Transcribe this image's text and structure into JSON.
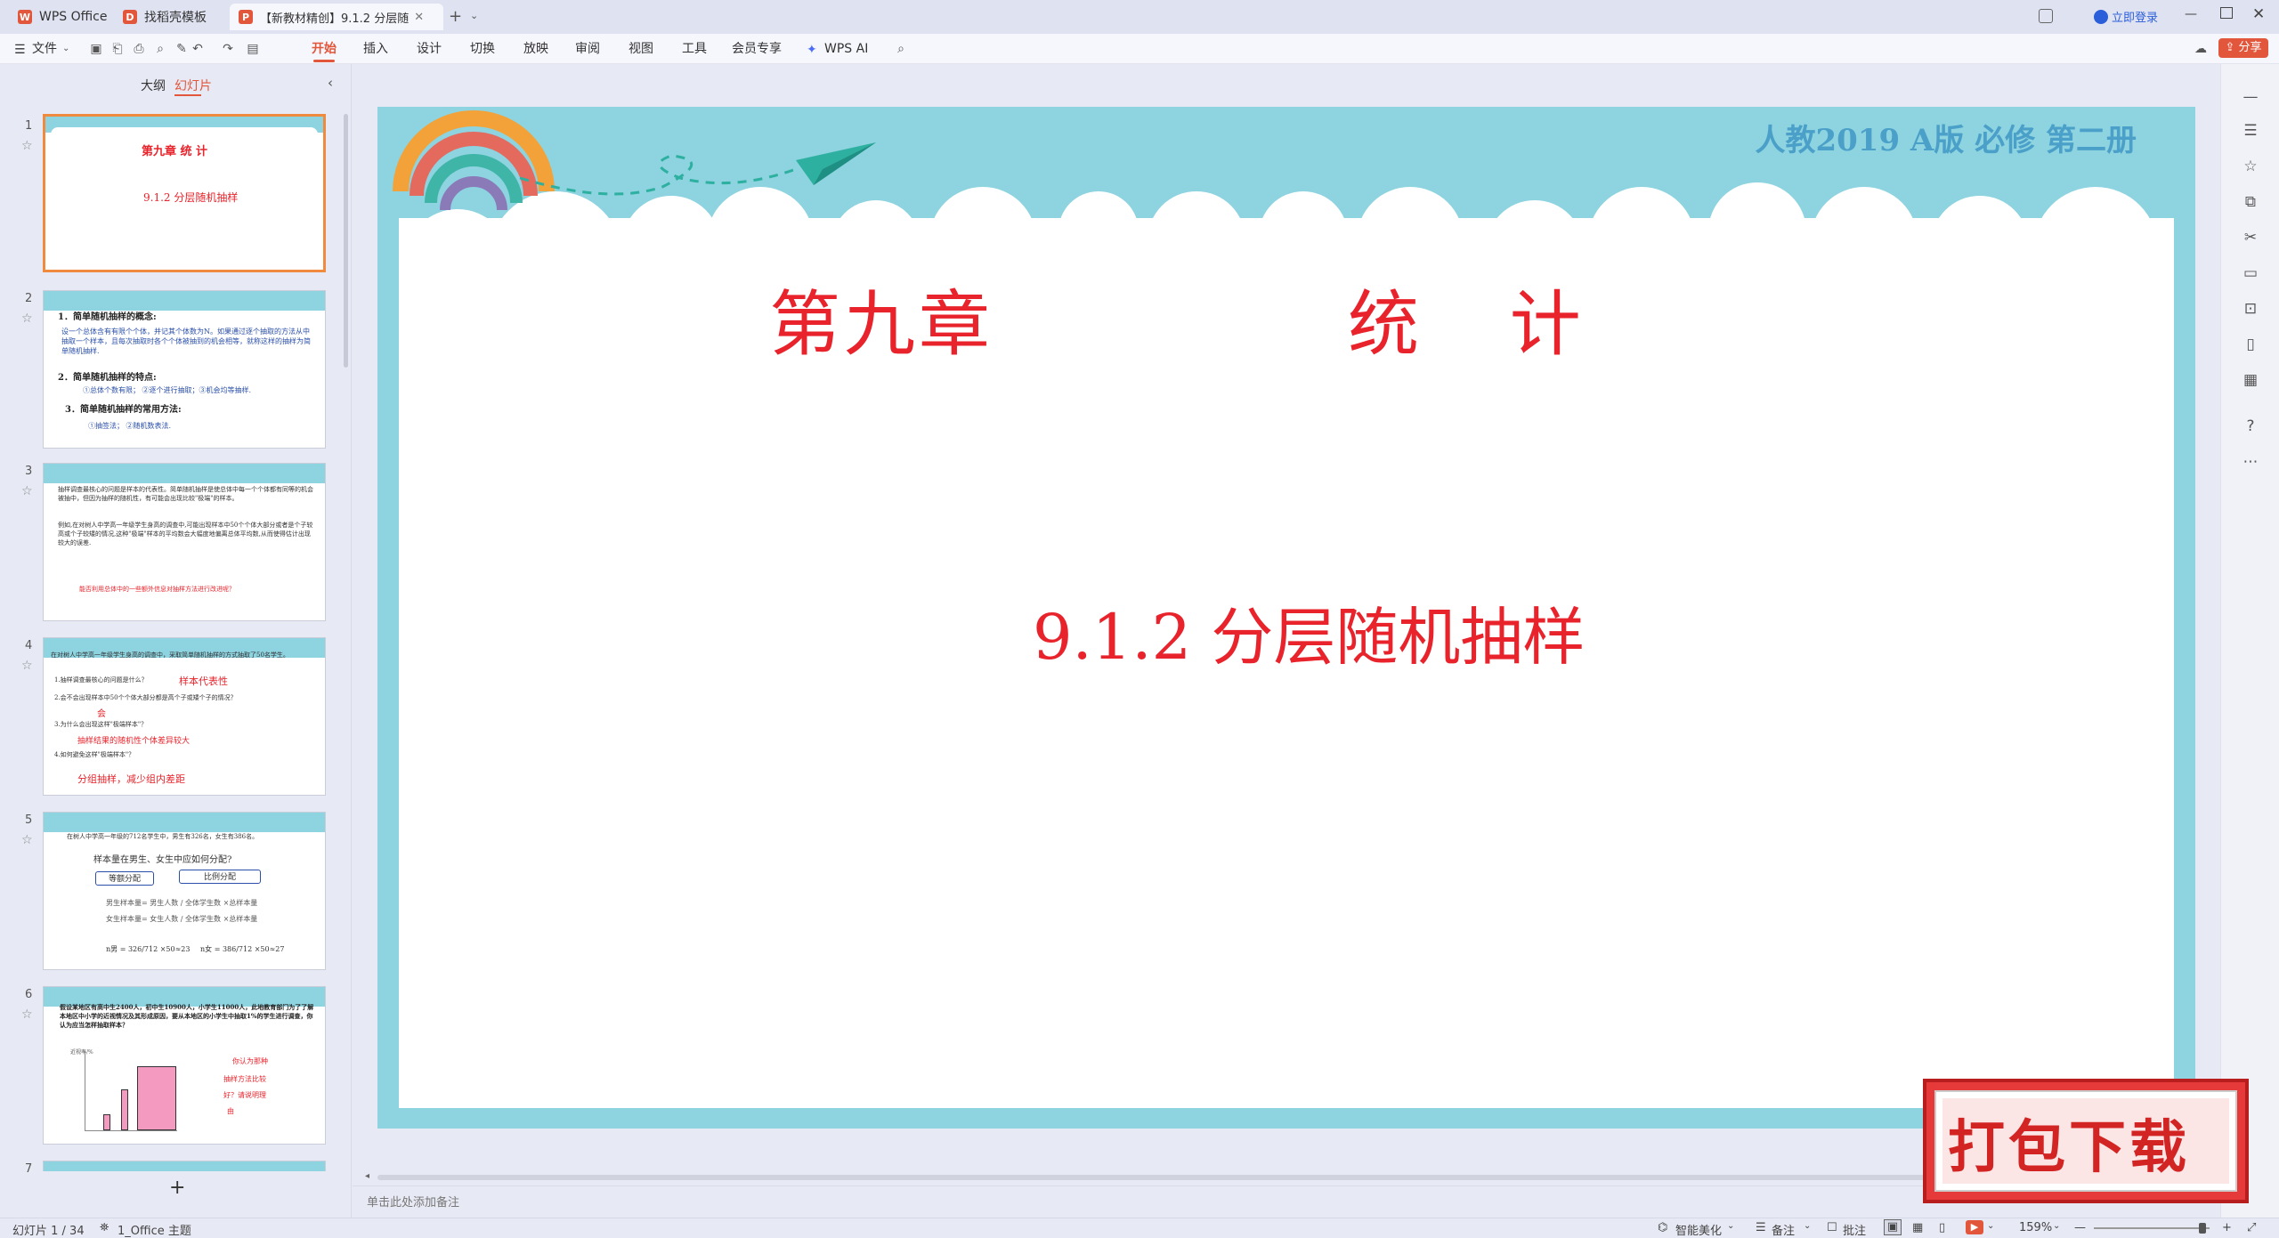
{
  "tabs": [
    {
      "label": "WPS Office"
    },
    {
      "label": "找稻壳模板"
    },
    {
      "label": "【新教材精创】9.1.2 分层随"
    }
  ],
  "titlebar": {
    "login": "立即登录",
    "share": "分享"
  },
  "menubar": {
    "file": "文件",
    "items": [
      "开始",
      "插入",
      "设计",
      "切换",
      "放映",
      "审阅",
      "视图",
      "工具",
      "会员专享",
      "WPS AI"
    ],
    "active": "开始"
  },
  "leftpanel": {
    "tab_outline": "大纲",
    "tab_slides": "幻灯片",
    "add_button": "+",
    "thumbs": [
      {
        "num": "1",
        "title": "第九章    统    计",
        "subtitle": "9.1.2 分层随机抽样"
      },
      {
        "num": "2",
        "lines": [
          "1．简单随机抽样的概念:",
          "设一个总体含有有限个个体，并记其个体数为N。如果通过逐个抽取的方法从中抽取一个样本，且每次抽取时各个个体被抽到的机会相等，就称这样的抽样为简单随机抽样.",
          "2．简单随机抽样的特点:",
          "①总体个数有限；   ②逐个进行抽取；③机会均等抽样.",
          "3．简单随机抽样的常用方法:",
          "①抽签法；      ②随机数表法."
        ]
      },
      {
        "num": "3",
        "lines": [
          "抽样调查最核心的问题是样本的代表性。简单随机抽样是使总体中每一个个体都有同等的机会被抽中，但因为抽样的随机性，有可能会出现比较\"极端\"的样本。",
          "例如,在对树人中学高一年级学生身高的调查中,可能出现样本中50个个体大部分或者是个子较高或个子较矮的情况,这种\"极端\"样本的平均数会大幅度地偏离总体平均数,从而使得估计出现较大的误差.",
          "能否利用总体中的一些额外信息对抽样方法进行改进呢？"
        ]
      },
      {
        "num": "4",
        "lines": [
          "在对树人中学高一年级学生身高的调查中，采取简单随机抽样的方式抽取了50名学生。",
          "1.抽样调查最核心的问题是什么？",
          "样本代表性",
          "2.会不会出现样本中50个个体大部分都是高个子或矮个子的情况？",
          "会",
          "3.为什么会出现这样\"极端样本\"？",
          "抽样结果的随机性个体差异较大",
          "4.如何避免这样\"极端样本\"？",
          "分组抽样，减少组内差距"
        ]
      },
      {
        "num": "5",
        "lines": [
          "在树人中学高一年级的712名学生中，男生有326名，女生有386名。",
          "样本量在男生、女生中应如何分配?",
          "等额分配",
          "比例分配",
          "男生样本量= 男生人数 / 全体学生数 ×总样本量",
          "女生样本量= 女生人数 / 全体学生数 ×总样本量",
          "n男 = 326/712 ×50≈23",
          "n女 = 386/712 ×50≈27"
        ]
      },
      {
        "num": "6",
        "lines": [
          "假设某地区有高中生2400人，初中生10900人，小学生11000人，此地教育部门为了了解本地区中小学的近视情况及其形成原因，要从本地区的小学生中抽取1%的学生进行调查，你认为应当怎样抽取样本？",
          "近视率/%",
          "你认为那种",
          "抽样方法比较",
          "好？请说明理",
          "由"
        ]
      },
      {
        "num": "7"
      }
    ]
  },
  "slide": {
    "header": "人教2019 A版 必修 第二册",
    "title": "第九章",
    "title2": "统    计",
    "subtitle": "9.1.2 分层随机抽样"
  },
  "notes_placeholder": "单击此处添加备注",
  "statusbar": {
    "slide_info": "幻灯片 1 / 34",
    "theme": "1_Office 主题",
    "smart": "智能美化",
    "notes": "备注",
    "comments": "批注",
    "zoom": "159%"
  },
  "promo": {
    "text": "打包下载"
  },
  "colors": {
    "accent": "#e2563b",
    "slide_bg": "#8dd3e0",
    "title_red": "#e8232b"
  }
}
